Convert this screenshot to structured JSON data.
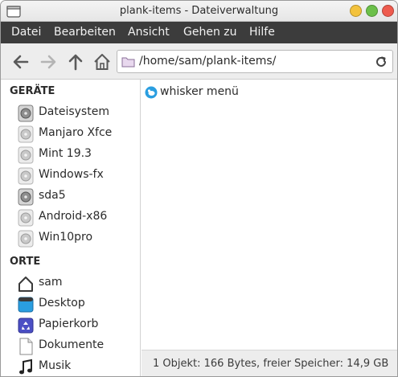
{
  "window": {
    "title": "plank-items - Dateiverwaltung",
    "buttons": [
      {
        "name": "minimize",
        "color": "#f3c23c"
      },
      {
        "name": "maximize",
        "color": "#6cc04a"
      },
      {
        "name": "close",
        "color": "#ee5b4e"
      }
    ]
  },
  "menubar": {
    "items": [
      "Datei",
      "Bearbeiten",
      "Ansicht",
      "Gehen zu",
      "Hilfe"
    ]
  },
  "toolbar": {
    "back_icon": "arrow-left-icon",
    "forward_icon": "arrow-right-icon",
    "up_icon": "arrow-up-icon",
    "home_icon": "home-icon",
    "path": "/home/sam/plank-items/",
    "reload_icon": "reload-icon"
  },
  "sidebar": {
    "devices_heading": "GERÄTE",
    "devices": [
      {
        "label": "Dateisystem",
        "icon": "drive-icon",
        "mounted": true
      },
      {
        "label": "Manjaro Xfce",
        "icon": "drive-icon",
        "mounted": false
      },
      {
        "label": "Mint 19.3",
        "icon": "drive-icon",
        "mounted": false
      },
      {
        "label": "Windows-fx",
        "icon": "drive-icon",
        "mounted": false
      },
      {
        "label": "sda5",
        "icon": "drive-icon",
        "mounted": true
      },
      {
        "label": "Android-x86",
        "icon": "drive-icon",
        "mounted": false
      },
      {
        "label": "Win10pro",
        "icon": "drive-icon",
        "mounted": false
      }
    ],
    "places_heading": "ORTE",
    "places": [
      {
        "label": "sam",
        "icon": "home-icon"
      },
      {
        "label": "Desktop",
        "icon": "desktop-icon"
      },
      {
        "label": "Papierkorb",
        "icon": "trash-icon"
      },
      {
        "label": "Dokumente",
        "icon": "document-icon"
      },
      {
        "label": "Musik",
        "icon": "music-icon"
      }
    ]
  },
  "main": {
    "files": [
      {
        "label": "whisker menü",
        "icon": "xfce-mouse-icon"
      }
    ]
  },
  "statusbar": {
    "text": "1 Objekt: 166 Bytes, freier Speicher: 14,9 GB"
  },
  "colors": {
    "menubar_bg": "#3c3c3c",
    "toolbar_bg": "#ededed",
    "accent": "#2a9ee0"
  }
}
